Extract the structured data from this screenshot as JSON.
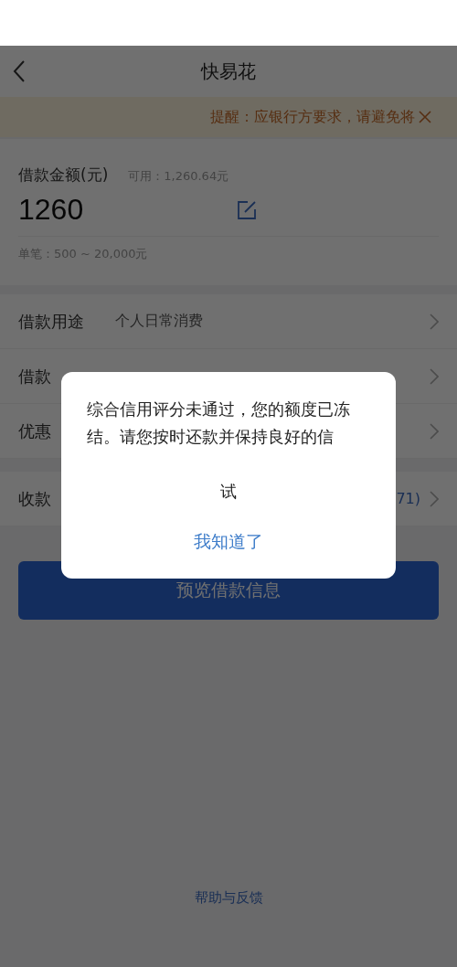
{
  "header": {
    "title": "快易花"
  },
  "notice": {
    "text": "提醒：应银行方要求，请避免将"
  },
  "amount_card": {
    "label": "借款金额(元)",
    "available": "可用：1,260.64元",
    "value": "1260",
    "range": "单笔：500 ~ 20,000元"
  },
  "rows": [
    {
      "label": "借款用途",
      "value": "个人日常消费"
    },
    {
      "label": "借款"
    },
    {
      "label": "优惠"
    }
  ],
  "account_row": {
    "label": "收款",
    "value": "71)"
  },
  "submit_button": "预览借款信息",
  "footer_link": "帮助与反馈",
  "dialog": {
    "message": [
      "综合信用评分未通过，您的额度已冻结。请您按时还款并保持良好的信",
      "试"
    ],
    "button": "我知道了"
  }
}
